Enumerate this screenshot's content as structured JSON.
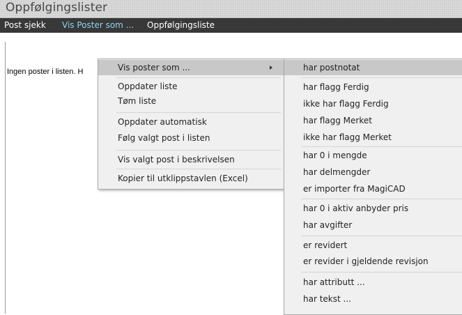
{
  "window": {
    "title": "Oppfølgingslister"
  },
  "menubar": {
    "items": [
      "Post sjekk",
      "Vis Poster som ...",
      "Oppfølgingsliste"
    ]
  },
  "main": {
    "empty_text": "Ingen poster i listen. H"
  },
  "context_menu": {
    "items": [
      "Vis poster som ...",
      "Oppdater liste",
      "Tøm liste",
      "Oppdater automatisk",
      "Følg valgt post i listen",
      "Vis valgt post i beskrivelsen",
      "Kopier til utklippstavlen (Excel)"
    ]
  },
  "submenu": {
    "items": [
      "har postnotat",
      "har flagg Ferdig",
      "ikke har flagg Ferdig",
      "har flagg Merket",
      "ikke har flagg Merket",
      "har 0 i mengde",
      "har delmengder",
      "er importer fra MagiCAD",
      "har 0 i aktiv anbyder pris",
      "har avgifter",
      "er revidert",
      "er revider i gjeldende revisjon",
      "har attributt ...",
      "har tekst ..."
    ]
  },
  "colors": {
    "menubar_bg": "#383838",
    "menubar_active": "#8fd3f4",
    "highlight": "#c8c8c8"
  }
}
